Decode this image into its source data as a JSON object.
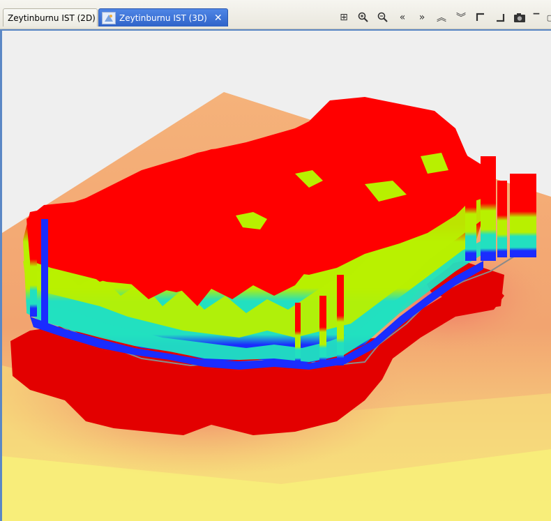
{
  "tabs": [
    {
      "label": "Zeytinburnu IST (2D)",
      "active": false
    },
    {
      "label": "Zeytinburnu IST (3D)",
      "active": true
    }
  ],
  "toolbar": {
    "icons": [
      "zoom-extent-icon",
      "zoom-in-icon",
      "zoom-out-icon",
      "pan-left-icon",
      "pan-right-icon",
      "pan-up-icon",
      "pan-down-icon",
      "top-left-view-icon",
      "bottom-right-view-icon",
      "camera-icon",
      "minimize-icon",
      "maximize-icon"
    ]
  },
  "colors": {
    "accent": "#3a6fd8",
    "background": "#efefef",
    "extrusion_top": "#ff0000",
    "band_yellow": "#b8f000",
    "band_cyan": "#22e0c0",
    "band_blue": "#1a2cff",
    "ground_orange": "#f3b07c",
    "ground_yellow": "#f8f07a"
  }
}
